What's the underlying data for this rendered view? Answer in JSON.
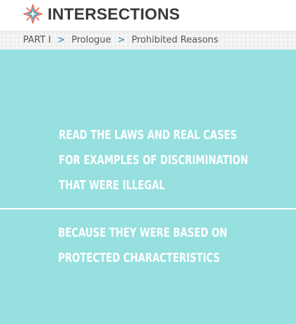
{
  "header": {
    "logo_icon": "compass-star-icon",
    "title": "INTERSECTIONS"
  },
  "breadcrumb": {
    "items": [
      "PART I",
      "Prologue",
      "Prohibited Reasons"
    ],
    "separator": ">"
  },
  "content": {
    "background_color": "#96e0df",
    "panel_1_lines": [
      "READ THE LAWS AND REAL CASES",
      "FOR EXAMPLES OF DISCRIMINATION",
      "THAT WERE ILLEGAL"
    ],
    "panel_2_lines": [
      "BECAUSE THEY WERE BASED ON",
      "PROTECTED CHARACTERISTICS"
    ]
  }
}
